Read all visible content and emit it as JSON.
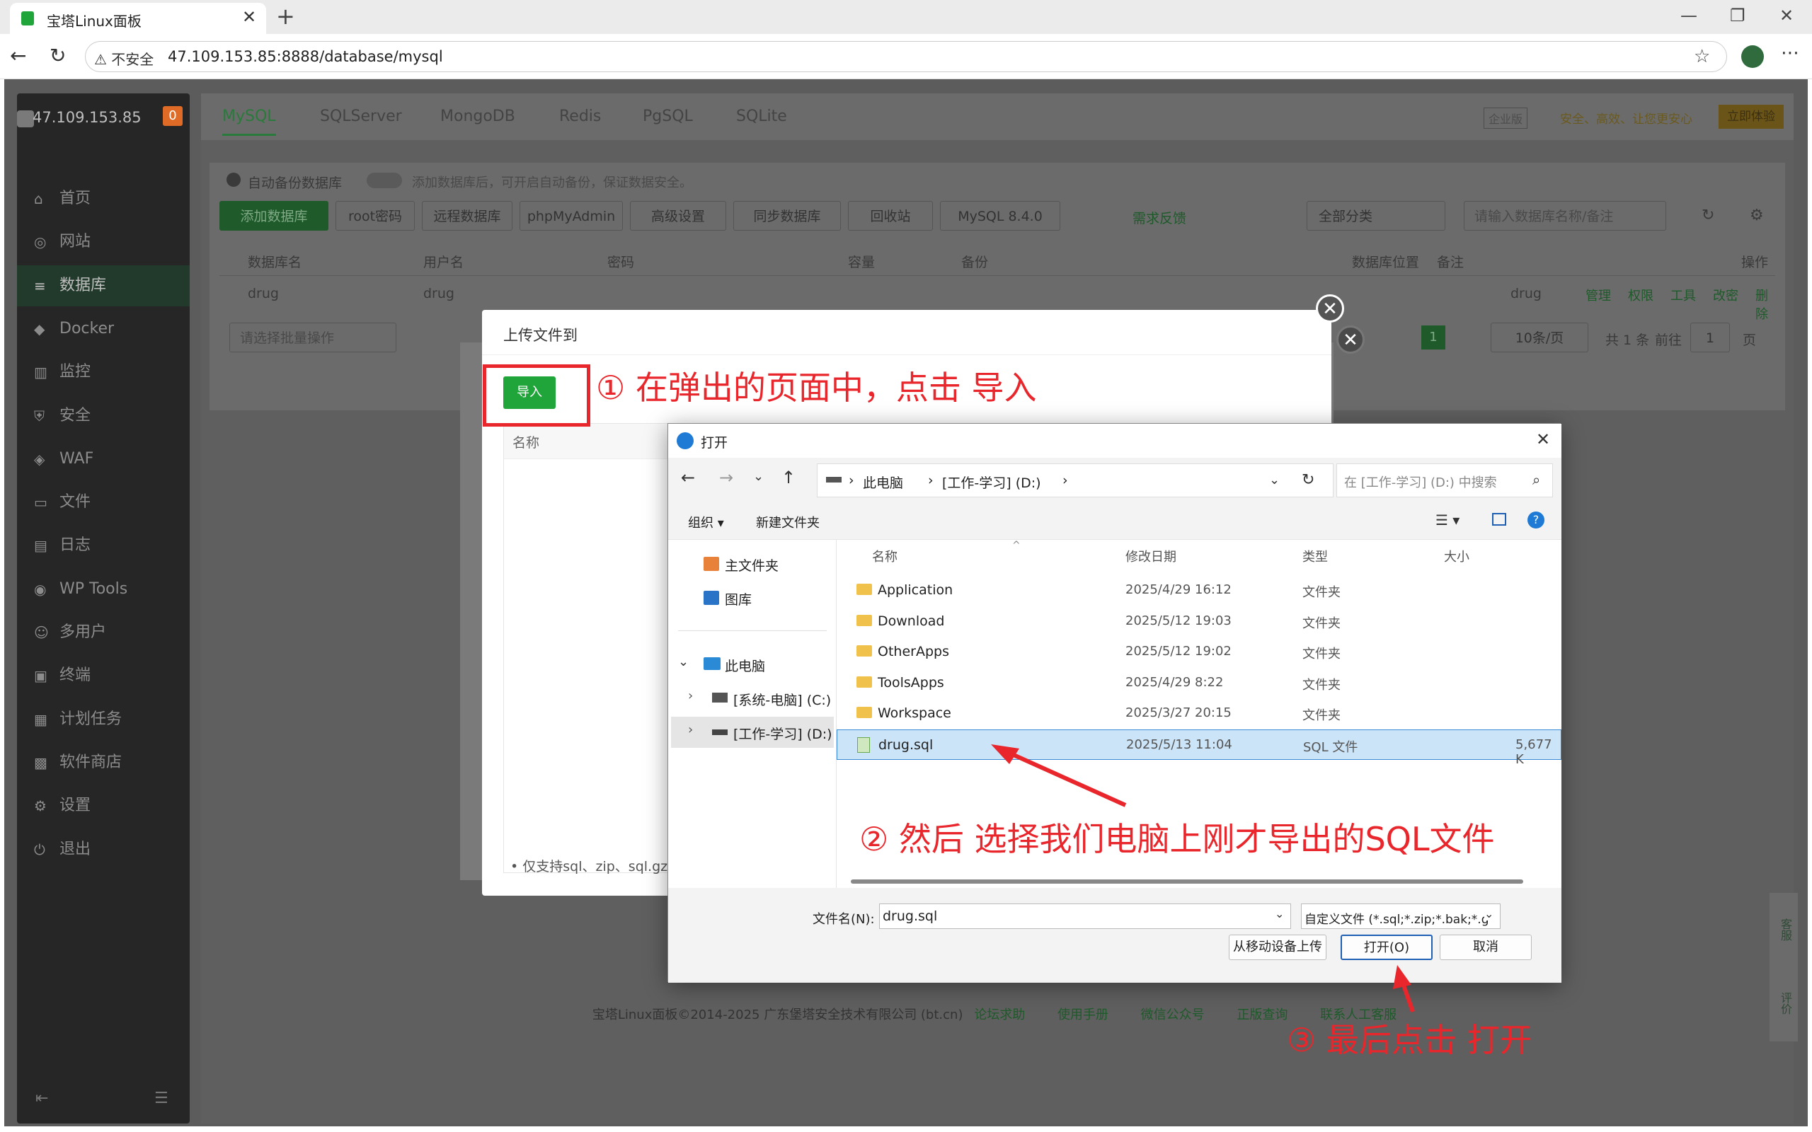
{
  "browser": {
    "tab_title": "宝塔Linux面板",
    "not_secure": "不安全",
    "url": "47.109.153.85:8888/database/mysql"
  },
  "sidebar": {
    "ip": "47.109.153.85",
    "badge": "0",
    "items": [
      "首页",
      "网站",
      "数据库",
      "Docker",
      "监控",
      "安全",
      "WAF",
      "文件",
      "日志",
      "WP Tools",
      "多用户",
      "终端",
      "计划任务",
      "软件商店",
      "设置",
      "退出"
    ]
  },
  "db_tabs": [
    "MySQL",
    "SQLServer",
    "MongoDB",
    "Redis",
    "PgSQL",
    "SQLite"
  ],
  "promo": {
    "tag": "企业版",
    "text": "安全、高效、让您更安心",
    "btn": "立即体验"
  },
  "toolbar": {
    "auto_backup": "自动备份数据库",
    "auto_backup_hint": "添加数据库后，可开启自动备份，保证数据安全。",
    "buttons": [
      "添加数据库",
      "root密码",
      "远程数据库",
      "phpMyAdmin",
      "高级设置",
      "同步数据库",
      "回收站",
      "MySQL 8.4.0"
    ],
    "feedback": "需求反馈",
    "category": "全部分类",
    "search_placeholder": "请输入数据库名称/备注"
  },
  "table": {
    "headers": [
      "数据库名",
      "用户名",
      "密码",
      "容量",
      "备份",
      "数据库位置",
      "备注",
      "操作"
    ],
    "row": {
      "name": "drug",
      "user": "drug",
      "note": "drug",
      "ops": [
        "管理",
        "权限",
        "工具",
        "改密",
        "删除"
      ]
    },
    "batch": "请选择批量操作",
    "page": "1",
    "per_page": "10条/页",
    "total": "共 1 条",
    "goto": "前往",
    "goto_page": "1",
    "page_unit": "页"
  },
  "upload_modal": {
    "title": "上传文件到",
    "import_btn": "导入",
    "col_name": "名称",
    "note": "仅支持sql、zip、sql.gz、"
  },
  "file_dialog": {
    "title": "打开",
    "breadcrumb": [
      "此电脑",
      "[工作-学习] (D:)"
    ],
    "search_placeholder": "在 [工作-学习] (D:) 中搜索",
    "organize": "组织",
    "new_folder": "新建文件夹",
    "left": [
      "主文件夹",
      "图库",
      "此电脑",
      "[系统-电脑] (C:)",
      "[工作-学习] (D:)"
    ],
    "columns": [
      "名称",
      "修改日期",
      "类型",
      "大小"
    ],
    "files": [
      {
        "name": "Application",
        "date": "2025/4/29 16:12",
        "type": "文件夹",
        "size": ""
      },
      {
        "name": "Download",
        "date": "2025/5/12 19:03",
        "type": "文件夹",
        "size": ""
      },
      {
        "name": "OtherApps",
        "date": "2025/5/12 19:02",
        "type": "文件夹",
        "size": ""
      },
      {
        "name": "ToolsApps",
        "date": "2025/4/29 8:22",
        "type": "文件夹",
        "size": ""
      },
      {
        "name": "Workspace",
        "date": "2025/3/27 20:15",
        "type": "文件夹",
        "size": ""
      },
      {
        "name": "drug.sql",
        "date": "2025/5/13 11:04",
        "type": "SQL 文件",
        "size": "5,677 K"
      }
    ],
    "filename_label": "文件名(N):",
    "filename_value": "drug.sql",
    "filter": "自定义文件 (*.sql;*.zip;*.bak;*.g",
    "mobile_upload": "从移动设备上传",
    "open_btn": "打开(O)",
    "cancel_btn": "取消"
  },
  "annotations": {
    "step1": "① 在弹出的页面中，点击 导入",
    "step2": "② 然后 选择我们电脑上刚才导出的SQL文件",
    "step3": "③ 最后点击 打开"
  },
  "side_float": [
    "客服",
    "评价"
  ],
  "footer": {
    "copyright": "宝塔Linux面板©2014-2025 广东堡塔安全技术有限公司 (bt.cn)",
    "links": [
      "论坛求助",
      "使用手册",
      "微信公众号",
      "正版查询",
      "联系人工客服"
    ]
  },
  "colors": {
    "brand_green": "#20a53a",
    "annotation_red": "#e8262b"
  }
}
